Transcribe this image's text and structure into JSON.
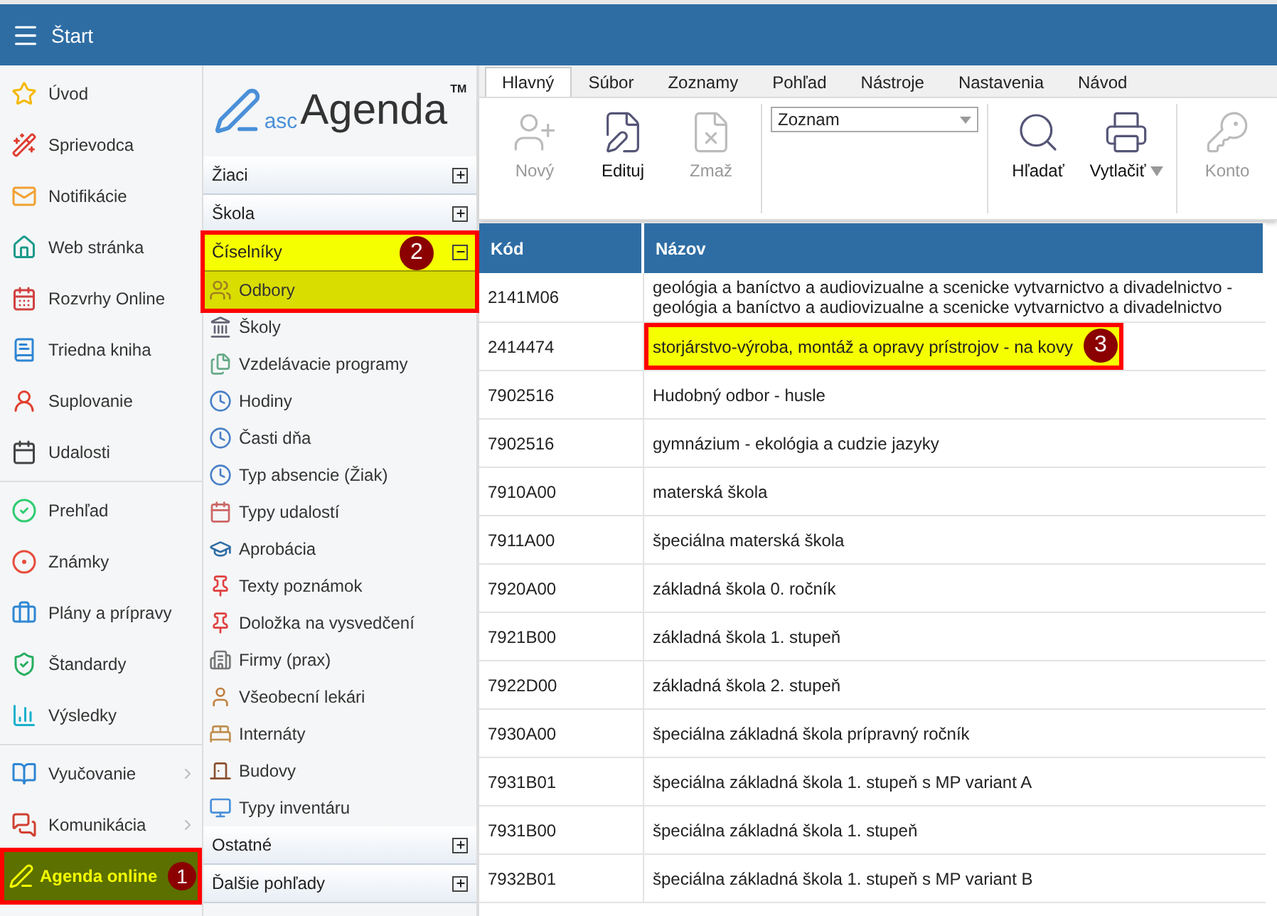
{
  "top_bar": {
    "title": "Štart"
  },
  "nav_groups": [
    {
      "items": [
        {
          "label": "Úvod",
          "selected": false,
          "submenu": false
        },
        {
          "label": "Sprievodca",
          "selected": false,
          "submenu": false
        },
        {
          "label": "Notifikácie",
          "selected": false,
          "submenu": false
        },
        {
          "label": "Web stránka",
          "selected": false,
          "submenu": false
        },
        {
          "label": "Rozvrhy Online",
          "selected": false,
          "submenu": false
        },
        {
          "label": "Triedna kniha",
          "selected": false,
          "submenu": false
        },
        {
          "label": "Suplovanie",
          "selected": false,
          "submenu": false
        },
        {
          "label": "Udalosti",
          "selected": false,
          "submenu": false
        }
      ]
    },
    {
      "items": [
        {
          "label": "Prehľad",
          "selected": false,
          "submenu": false
        },
        {
          "label": "Známky",
          "selected": false,
          "submenu": false
        },
        {
          "label": "Plány a prípravy",
          "selected": false,
          "submenu": false
        },
        {
          "label": "Štandardy",
          "selected": false,
          "submenu": false
        },
        {
          "label": "Výsledky",
          "selected": false,
          "submenu": false
        }
      ]
    },
    {
      "items": [
        {
          "label": "Vyučovanie",
          "selected": false,
          "submenu": true
        },
        {
          "label": "Komunikácia",
          "selected": false,
          "submenu": true
        },
        {
          "label": "Agenda online",
          "selected": true,
          "submenu": false,
          "callout": "1"
        }
      ]
    }
  ],
  "logo": {
    "prefix": "asc",
    "name": "Agenda",
    "mark": "TM"
  },
  "sections": [
    {
      "title": "Žiaci",
      "expanded": false,
      "highlighted": false
    },
    {
      "title": "Škola",
      "expanded": false,
      "highlighted": false
    },
    {
      "title": "Číselníky",
      "expanded": true,
      "highlighted": true,
      "callout": "2",
      "items": [
        {
          "label": "Odbory",
          "selected": true
        },
        {
          "label": "Školy",
          "selected": false
        },
        {
          "label": "Vzdelávacie programy",
          "selected": false
        },
        {
          "label": "Hodiny",
          "selected": false
        },
        {
          "label": "Časti dňa",
          "selected": false
        },
        {
          "label": "Typ absencie (Žiak)",
          "selected": false
        },
        {
          "label": "Typy udalostí",
          "selected": false
        },
        {
          "label": "Aprobácia",
          "selected": false
        },
        {
          "label": "Texty poznámok",
          "selected": false
        },
        {
          "label": "Doložka na vysvedčení",
          "selected": false
        },
        {
          "label": "Firmy (prax)",
          "selected": false
        },
        {
          "label": "Všeobecní lekári",
          "selected": false
        },
        {
          "label": "Internáty",
          "selected": false
        },
        {
          "label": "Budovy",
          "selected": false
        },
        {
          "label": "Typy inventáru",
          "selected": false
        }
      ]
    },
    {
      "title": "Ostatné",
      "expanded": false,
      "highlighted": false
    },
    {
      "title": "Ďalšie pohľady",
      "expanded": false,
      "highlighted": false
    }
  ],
  "ribbon_tabs": [
    {
      "label": "Hlavný",
      "selected": true
    },
    {
      "label": "Súbor",
      "selected": false
    },
    {
      "label": "Zoznamy",
      "selected": false
    },
    {
      "label": "Pohľad",
      "selected": false
    },
    {
      "label": "Nástroje",
      "selected": false
    },
    {
      "label": "Nastavenia",
      "selected": false
    },
    {
      "label": "Návod",
      "selected": false
    }
  ],
  "toolbar_groups": [
    {
      "kind": "buttons",
      "buttons": [
        {
          "label": "Nový",
          "disabled": true,
          "menu": false
        },
        {
          "label": "Edituj",
          "disabled": false,
          "menu": false
        },
        {
          "label": "Zmaž",
          "disabled": true,
          "menu": false
        }
      ]
    },
    {
      "kind": "select",
      "value": "Zoznam"
    },
    {
      "kind": "buttons",
      "buttons": [
        {
          "label": "Hľadať",
          "disabled": false,
          "menu": false
        },
        {
          "label": "Vytlačiť",
          "disabled": false,
          "menu": true
        }
      ]
    },
    {
      "kind": "buttons",
      "buttons": [
        {
          "label": "Konto",
          "disabled": true,
          "menu": false
        }
      ]
    }
  ],
  "table": {
    "columns": [
      "Kód",
      "Názov"
    ],
    "rows": [
      {
        "code": "2141M06",
        "name": "geológia a baníctvo a audiovizualne a scenicke vytvarnictvo a divadelnictvo - geológia a baníctvo a audiovizualne a scenicke vytvarnictvo a divadelnictvo",
        "highlighted": false
      },
      {
        "code": "2414474",
        "name": "storjárstvo-výroba, montáž a opravy prístrojov - na kovy",
        "highlighted": true,
        "callout": "3"
      },
      {
        "code": "7902516",
        "name": "Hudobný odbor - husle",
        "highlighted": false
      },
      {
        "code": "7902516",
        "name": "gymnázium - ekológia a cudzie jazyky",
        "highlighted": false
      },
      {
        "code": "7910A00",
        "name": "materská škola",
        "highlighted": false
      },
      {
        "code": "7911A00",
        "name": "špeciálna materská škola",
        "highlighted": false
      },
      {
        "code": "7920A00",
        "name": "základná škola 0. ročník",
        "highlighted": false
      },
      {
        "code": "7921B00",
        "name": "základná škola 1. stupeň",
        "highlighted": false
      },
      {
        "code": "7922D00",
        "name": "základná škola 2. stupeň",
        "highlighted": false
      },
      {
        "code": "7930A00",
        "name": "špeciálna základná škola prípravný ročník",
        "highlighted": false
      },
      {
        "code": "7931B01",
        "name": "špeciálna základná škola 1. stupeň s MP variant A",
        "highlighted": false
      },
      {
        "code": "7931B00",
        "name": "špeciálna základná škola 1. stupeň",
        "highlighted": false
      },
      {
        "code": "7932B01",
        "name": "špeciálna základná škola 1. stupeň s MP variant B",
        "highlighted": false
      }
    ]
  }
}
